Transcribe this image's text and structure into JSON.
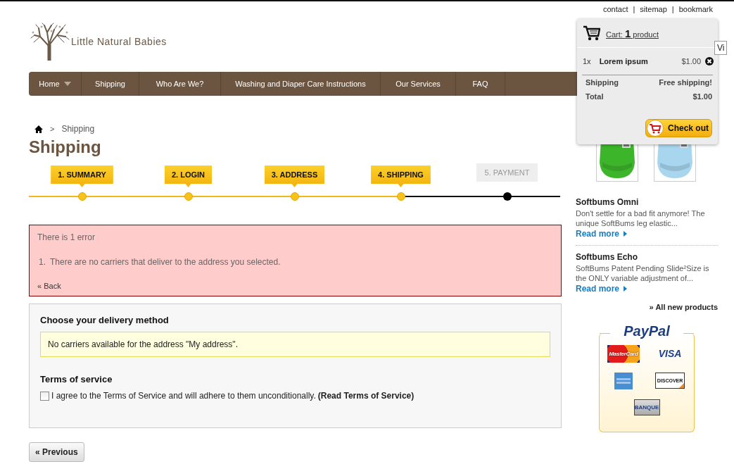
{
  "header": {
    "links": [
      "contact",
      "sitemap",
      "bookmark"
    ],
    "separator": "|",
    "logo_text": "Little Natural Babies"
  },
  "nav": {
    "items": [
      {
        "label": "Home",
        "has_submenu": true
      },
      {
        "label": "Shipping",
        "has_submenu": false
      },
      {
        "label": "Who Are We?",
        "has_submenu": false
      },
      {
        "label": "Washing and Diaper Care Instructions",
        "has_submenu": false
      },
      {
        "label": "Our Services",
        "has_submenu": false
      },
      {
        "label": "FAQ",
        "has_submenu": false
      }
    ]
  },
  "breadcrumb": {
    "separator": ">",
    "current": "Shipping"
  },
  "page_title": "Shipping",
  "steps": [
    {
      "label": "1. SUMMARY",
      "reached": true
    },
    {
      "label": "2. LOGIN",
      "reached": true
    },
    {
      "label": "3. ADDRESS",
      "reached": true
    },
    {
      "label": "4. SHIPPING",
      "reached": true
    },
    {
      "label": "5. PAYMENT",
      "reached": false
    }
  ],
  "error": {
    "heading": "There is 1 error",
    "items": [
      {
        "number": "1.",
        "text": "There are no carriers that deliver to the address you selected."
      }
    ],
    "back_link": "« Back"
  },
  "delivery": {
    "title": "Choose your delivery method",
    "warning": "No carriers available for the address \"My address\".",
    "terms_title": "Terms of service",
    "terms_checked": false,
    "terms_text": "I agree to the Terms of Service and will adhere to them unconditionally.",
    "terms_link": "(Read Terms of Service)"
  },
  "previous_button": "« Previous",
  "tooltip": "Vi",
  "cart": {
    "label": "Cart:",
    "count": "1",
    "unit": "product",
    "items": [
      {
        "quantity": "1x",
        "name": "Lorem ipsum",
        "price": "$1.00"
      }
    ],
    "shipping_label": "Shipping",
    "shipping_value": "Free shipping!",
    "total_label": "Total",
    "total_value": "$1.00",
    "checkout": "Check out"
  },
  "sidebar": {
    "products": [
      {
        "title": "Softbums Omni",
        "description": "Don't settle for a bad fit anymore!  The unique SoftBums leg elastic...",
        "link": "Read more"
      },
      {
        "title": "Softbums Echo",
        "description": "SoftBums Patent Pending Slide²Size is the ONLY variable adjustment of...",
        "link": "Read more"
      }
    ],
    "all_new": "» All new products",
    "paypal": {
      "title": "PayPal",
      "methods": [
        {
          "kind": "mastercard",
          "label": "MasterCard"
        },
        {
          "kind": "visa",
          "label": "VISA"
        },
        {
          "kind": "amex"
        },
        {
          "kind": "discover",
          "label": "DISCOVER"
        },
        {
          "kind": "banque",
          "label": "BANQUE"
        }
      ]
    }
  }
}
